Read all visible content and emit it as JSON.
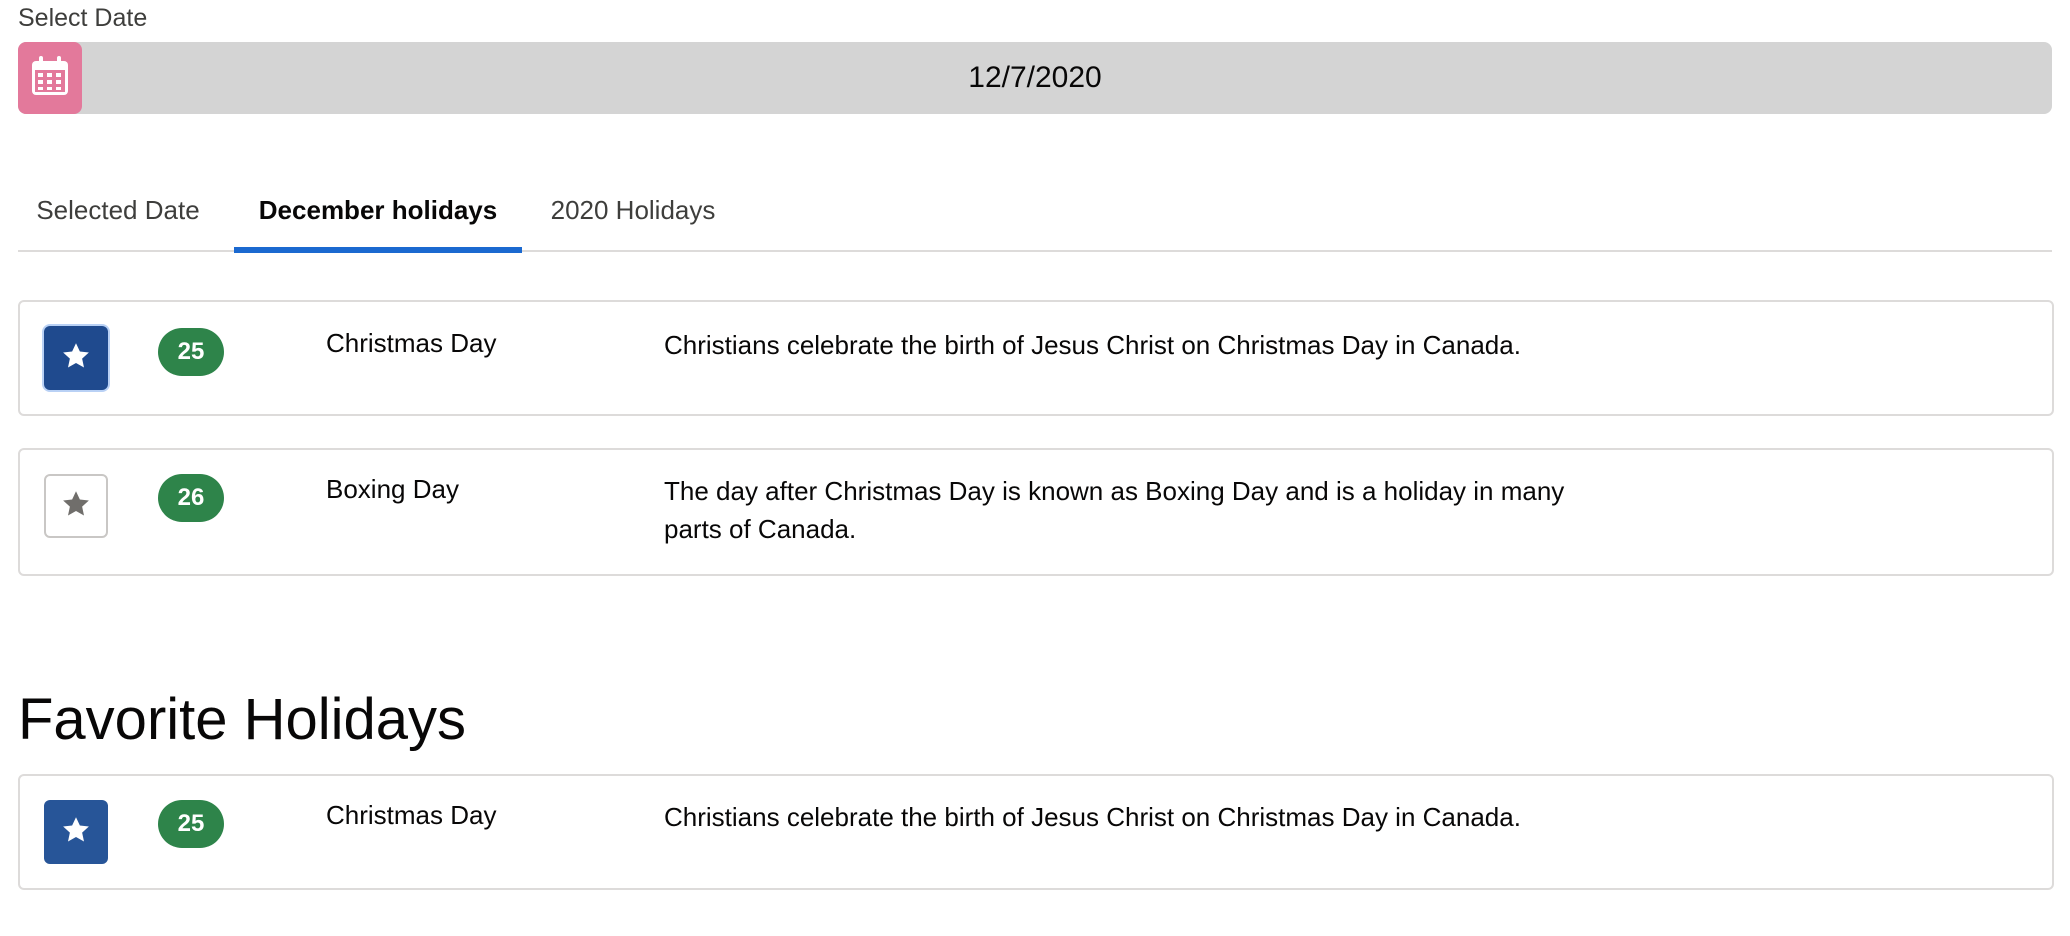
{
  "date_picker": {
    "label": "Select Date",
    "value": "12/7/2020",
    "icon": "calendar-icon",
    "icon_color": "#e3799b"
  },
  "tabs": [
    {
      "label": "Selected Date",
      "active": false
    },
    {
      "label": "December holidays",
      "active": true
    },
    {
      "label": "2020 Holidays",
      "active": false
    }
  ],
  "december_holidays": [
    {
      "favorite": true,
      "day": "25",
      "name": "Christmas Day",
      "description": "Christians celebrate the birth of Jesus Christ on Christmas Day in Canada."
    },
    {
      "favorite": false,
      "day": "26",
      "name": "Boxing Day",
      "description": "The day after Christmas Day is known as Boxing Day and is a holiday in many parts of Canada."
    }
  ],
  "favorites": {
    "title": "Favorite Holidays",
    "items": [
      {
        "favorite": true,
        "day": "25",
        "name": "Christmas Day",
        "description": "Christians celebrate the birth of Jesus Christ on Christmas Day in Canada."
      }
    ]
  },
  "colors": {
    "accent": "#1b69d0",
    "favorite_on": "#1f4a8e",
    "badge": "#2e844a",
    "date_bar": "#d4d4d4"
  }
}
